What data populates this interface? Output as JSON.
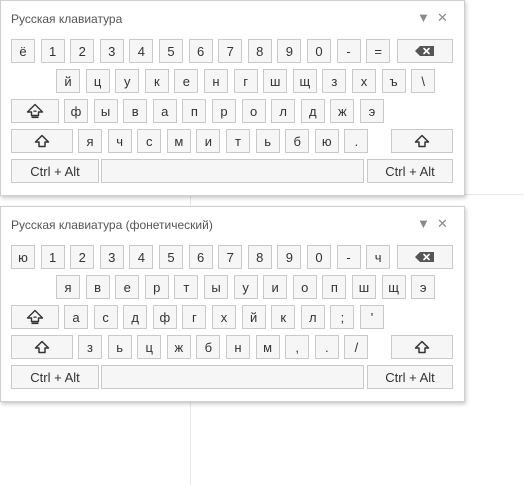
{
  "keyboards": [
    {
      "title": "Русская клавиатура",
      "controls": {
        "minimize": "▼",
        "close": "✕"
      },
      "rows": [
        [
          "ё",
          "1",
          "2",
          "3",
          "4",
          "5",
          "6",
          "7",
          "8",
          "9",
          "0",
          "-",
          "=",
          "backspace-icon"
        ],
        [
          "й",
          "ц",
          "у",
          "к",
          "е",
          "н",
          "г",
          "ш",
          "щ",
          "з",
          "х",
          "ъ",
          "\\"
        ],
        [
          "caps-lock-icon",
          "ф",
          "ы",
          "в",
          "а",
          "п",
          "р",
          "о",
          "л",
          "д",
          "ж",
          "э"
        ],
        [
          "shift-icon",
          "я",
          "ч",
          "с",
          "м",
          "и",
          "т",
          "ь",
          "б",
          "ю",
          ".",
          "shift-icon"
        ],
        [
          "Ctrl + Alt",
          "space",
          "Ctrl + Alt"
        ]
      ]
    },
    {
      "title": "Русская клавиатура (фонетический)",
      "controls": {
        "minimize": "▼",
        "close": "✕"
      },
      "rows": [
        [
          "ю",
          "1",
          "2",
          "3",
          "4",
          "5",
          "6",
          "7",
          "8",
          "9",
          "0",
          "-",
          "ч",
          "backspace-icon"
        ],
        [
          "я",
          "в",
          "е",
          "р",
          "т",
          "ы",
          "у",
          "и",
          "о",
          "п",
          "ш",
          "щ",
          "э"
        ],
        [
          "caps-lock-icon",
          "а",
          "с",
          "д",
          "ф",
          "г",
          "х",
          "й",
          "к",
          "л",
          ";",
          "'"
        ],
        [
          "shift-icon",
          "з",
          "ь",
          "ц",
          "ж",
          "б",
          "н",
          "м",
          ",",
          ".",
          "/",
          "shift-icon"
        ],
        [
          "Ctrl + Alt",
          "space",
          "Ctrl + Alt"
        ]
      ]
    }
  ]
}
